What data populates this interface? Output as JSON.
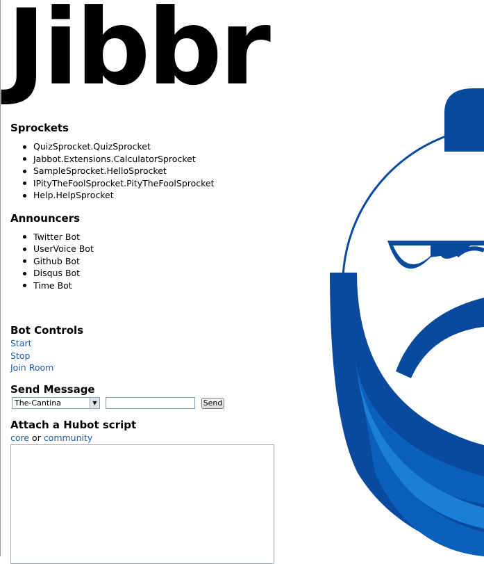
{
  "logo": "Jibbr",
  "sprockets": {
    "heading": "Sprockets",
    "items": [
      "QuizSprocket.QuizSprocket",
      "Jabbot.Extensions.CalculatorSprocket",
      "SampleSprocket.HelloSprocket",
      "IPityTheFoolSprocket.PityTheFoolSprocket",
      "Help.HelpSprocket"
    ]
  },
  "announcers": {
    "heading": "Announcers",
    "items": [
      "Twitter Bot",
      "UserVoice Bot",
      "Github Bot",
      "Disqus Bot",
      "Time Bot"
    ]
  },
  "bot_controls": {
    "heading": "Bot Controls",
    "start": "Start",
    "stop": "Stop",
    "join_room": "Join Room"
  },
  "send_message": {
    "heading": "Send Message",
    "room_selected": "The-Cantina",
    "message_value": "",
    "send_label": "Send"
  },
  "hubot": {
    "heading": "Attach a Hubot script",
    "core_link": "core",
    "or_text": " or ",
    "community_link": "community",
    "script_value": ""
  },
  "colors": {
    "link": "#1f5aa8",
    "mascot_dark": "#0a4a9e",
    "mascot_mid": "#0b5fbd",
    "mascot_light": "#1b7fd8"
  }
}
